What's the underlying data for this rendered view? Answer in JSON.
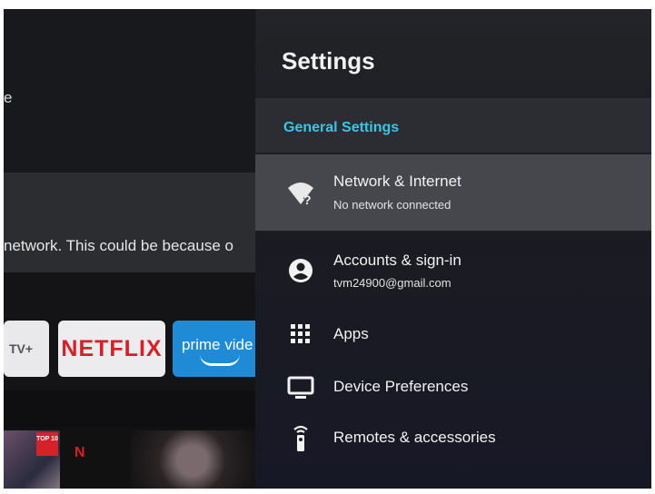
{
  "background": {
    "partial_heading": "e",
    "message": "network. This could be because o",
    "apps": [
      {
        "name": "tv-plus",
        "label": "TV+"
      },
      {
        "name": "netflix",
        "label": "NETFLIX"
      },
      {
        "name": "prime-video",
        "label": "prime vide"
      }
    ],
    "badges": {
      "top10": "TOP 10",
      "netflix_n": "N"
    }
  },
  "settings": {
    "title": "Settings",
    "section_header": "General Settings",
    "items": [
      {
        "label": "Network & Internet",
        "subtitle": "No network connected",
        "icon": "wifi-question-icon",
        "selected": true
      },
      {
        "label": "Accounts & sign-in",
        "subtitle": "tvm24900@gmail.com",
        "icon": "account-icon"
      },
      {
        "label": "Apps",
        "icon": "apps-grid-icon"
      },
      {
        "label": "Device Preferences",
        "icon": "tv-monitor-icon"
      },
      {
        "label": "Remotes & accessories",
        "icon": "remote-icon"
      }
    ],
    "colors": {
      "accent": "#38c7e6",
      "selected_bg": "#45474d"
    }
  }
}
